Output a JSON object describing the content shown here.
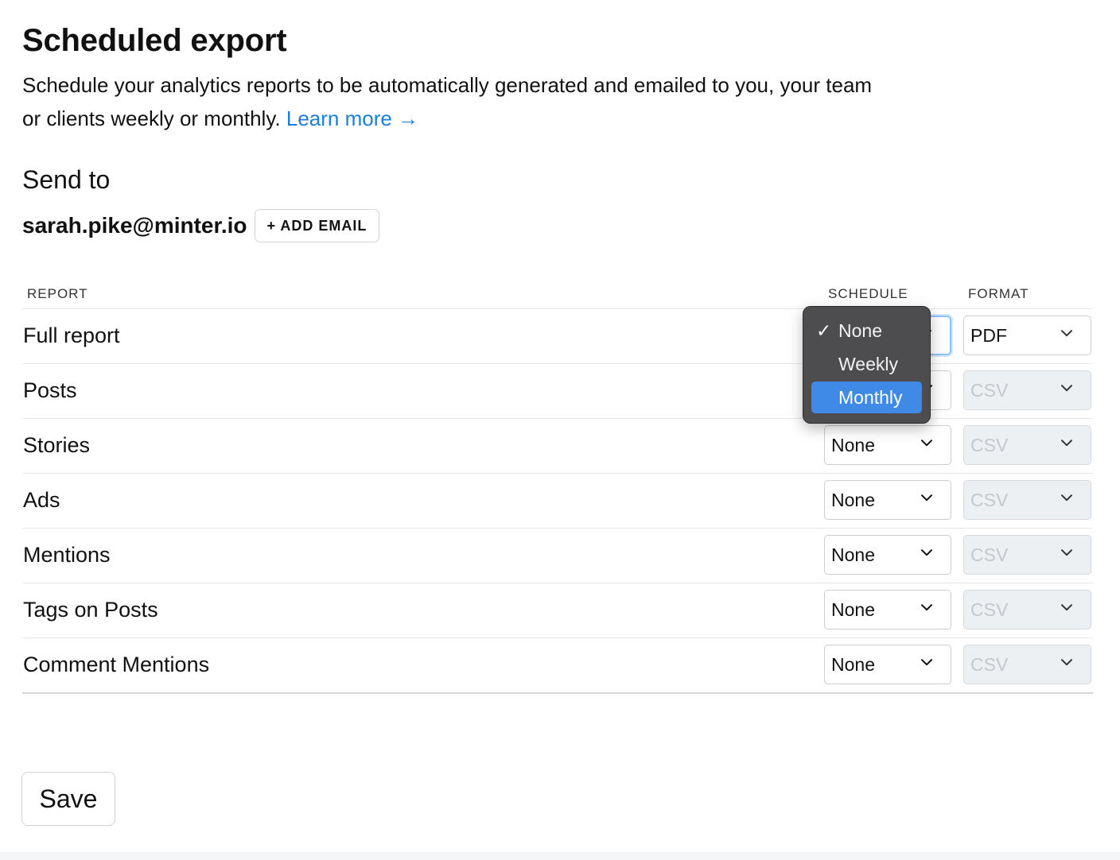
{
  "header": {
    "title": "Scheduled export",
    "description": "Schedule your analytics reports to be automatically generated and emailed to you, your team or clients weekly or monthly.",
    "learn_more": "Learn more →"
  },
  "send_to": {
    "heading": "Send to",
    "email": "sarah.pike@minter.io",
    "add_email_label": "+ ADD EMAIL"
  },
  "table": {
    "columns": {
      "report": "REPORT",
      "schedule": "SCHEDULE",
      "format": "FORMAT"
    },
    "rows": [
      {
        "label": "Full report",
        "schedule": "",
        "format": "PDF",
        "format_disabled": false
      },
      {
        "label": "Posts",
        "schedule": "",
        "format": "CSV",
        "format_disabled": true
      },
      {
        "label": "Stories",
        "schedule": "None",
        "format": "CSV",
        "format_disabled": true
      },
      {
        "label": "Ads",
        "schedule": "None",
        "format": "CSV",
        "format_disabled": true
      },
      {
        "label": "Mentions",
        "schedule": "None",
        "format": "CSV",
        "format_disabled": true
      },
      {
        "label": "Tags on Posts",
        "schedule": "None",
        "format": "CSV",
        "format_disabled": true
      },
      {
        "label": "Comment Mentions",
        "schedule": "None",
        "format": "CSV",
        "format_disabled": true
      }
    ]
  },
  "schedule_dropdown": {
    "open_for_row": "Full report",
    "options": [
      "None",
      "Weekly",
      "Monthly"
    ],
    "checked": "None",
    "highlighted": "Monthly"
  },
  "save_label": "Save",
  "colors": {
    "link": "#1a7fe0",
    "menu_bg": "#4d4d4f",
    "menu_highlight": "#3f8ae6",
    "focus": "#8ec0f6"
  }
}
